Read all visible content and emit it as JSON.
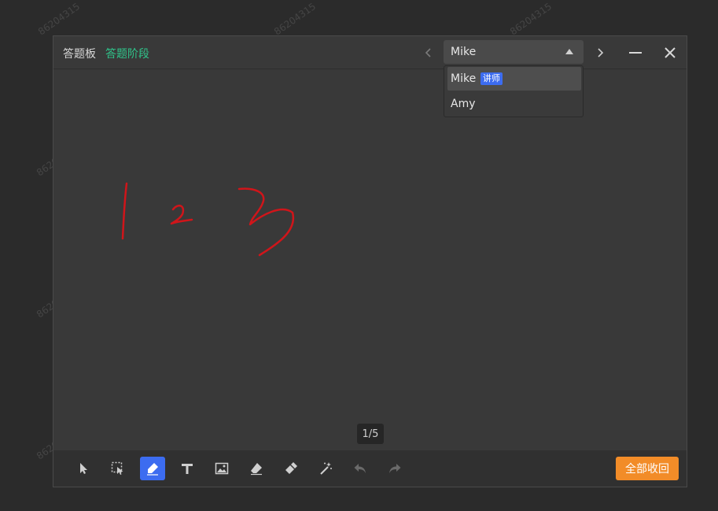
{
  "background_watermark": "86204315",
  "window": {
    "title": "答题板",
    "stage": "答题阶段"
  },
  "student_select": {
    "selected": "Mike",
    "options": [
      {
        "name": "Mike",
        "badge": "讲师",
        "active": true
      },
      {
        "name": "Amy",
        "badge": "",
        "active": false
      }
    ]
  },
  "board": {
    "page_indicator": "1/5",
    "ink_color": "#d0151a",
    "drawn_content": "1 2 3"
  },
  "toolbar": {
    "tools": [
      "pointer",
      "area-select",
      "pen",
      "text",
      "image",
      "eraser",
      "clear-brush",
      "magic-wand",
      "undo",
      "redo"
    ],
    "active_tool": "pen",
    "collapse_all_label": "全部收回"
  },
  "colors": {
    "stage_green": "#2fc58b",
    "accent_blue": "#3c6cf0",
    "collapse_orange": "#f28c28"
  }
}
